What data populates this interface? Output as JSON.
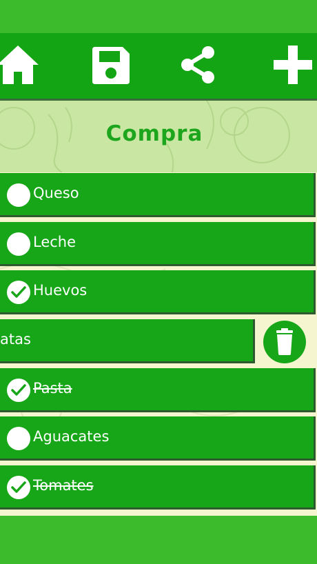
{
  "toolbar": {
    "icons": [
      "home-icon",
      "save-icon",
      "share-icon",
      "add-icon"
    ],
    "bar_color": "#14a514"
  },
  "header": {
    "title": "Compra"
  },
  "items": [
    {
      "label": "Queso",
      "checked": false,
      "struck": false
    },
    {
      "label": "Leche",
      "checked": false,
      "struck": false
    },
    {
      "label": "Huevos",
      "checked": true,
      "struck": false
    },
    {
      "label": "atas",
      "checked": false,
      "struck": false,
      "swiped": true
    },
    {
      "label": "Pasta",
      "checked": true,
      "struck": true
    },
    {
      "label": "Aguacates",
      "checked": false,
      "struck": false
    },
    {
      "label": "Tomates",
      "checked": true,
      "struck": true
    }
  ],
  "delete_action": {
    "icon": "trash-icon"
  },
  "colors": {
    "status_bar": "#3cbc2c",
    "row_green": "#16a618",
    "title_green": "#1ea51e",
    "background": "#f5f6d0"
  }
}
